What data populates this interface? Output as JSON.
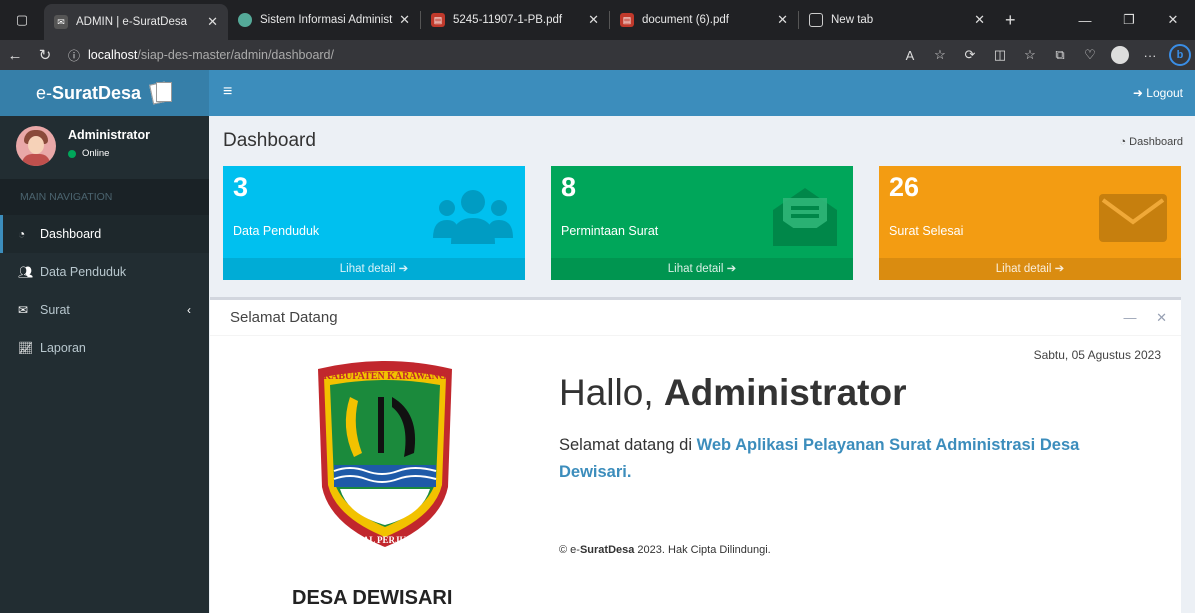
{
  "browser": {
    "tabs": [
      {
        "title": "ADMIN | e-SuratDesa",
        "active": true
      },
      {
        "title": "Sistem Informasi Administras",
        "active": false
      },
      {
        "title": "5245-11907-1-PB.pdf",
        "active": false
      },
      {
        "title": "document (6).pdf",
        "active": false
      },
      {
        "title": "New tab",
        "active": false
      }
    ],
    "url_host": "localhost",
    "url_path": "/siap-des-master/admin/dashboard/"
  },
  "app": {
    "logo_prefix": "e-",
    "logo_bold": "SuratDesa",
    "logout_label": "Logout",
    "user": {
      "name": "Administrator",
      "status": "Online"
    },
    "nav_header": "MAIN NAVIGATION",
    "menu": [
      {
        "label": "Dashboard",
        "icon": "dashboard-icon",
        "active": true
      },
      {
        "label": "Data Penduduk",
        "icon": "users-icon",
        "active": false
      },
      {
        "label": "Surat",
        "icon": "envelope-icon",
        "active": false
      },
      {
        "label": "Laporan",
        "icon": "chart-icon",
        "active": false
      }
    ],
    "page_title": "Dashboard",
    "breadcrumb": "Dashboard",
    "stats": [
      {
        "value": "3",
        "label": "Data Penduduk",
        "link": "Lihat detail",
        "color": "#00c0ef",
        "icon": "users-icon"
      },
      {
        "value": "8",
        "label": "Permintaan Surat",
        "link": "Lihat detail",
        "color": "#00a65a",
        "icon": "envelope-open-icon"
      },
      {
        "value": "26",
        "label": "Surat Selesai",
        "link": "Lihat detail",
        "color": "#f39c12",
        "icon": "envelope-icon"
      }
    ],
    "welcome_box": {
      "title": "Selamat Datang",
      "date": "Sabtu, 05 Agustus 2023",
      "greeting_prefix": "Hallo, ",
      "greeting_name": "Administrator",
      "welcome_prefix": "Selamat datang di ",
      "welcome_link": "Web Aplikasi Pelayanan Surat Administrasi Desa Dewisari.",
      "copyright_prefix": "© e-",
      "copyright_brand": "SuratDesa",
      "copyright_suffix": " 2023. Hak Cipta Dilindungi.",
      "emblem_top_text": "KABUPATEN KARAWANG",
      "emblem_bottom_text": "PANGKAL PERJUANGAN",
      "desa_name": "DESA DEWISARI"
    }
  }
}
